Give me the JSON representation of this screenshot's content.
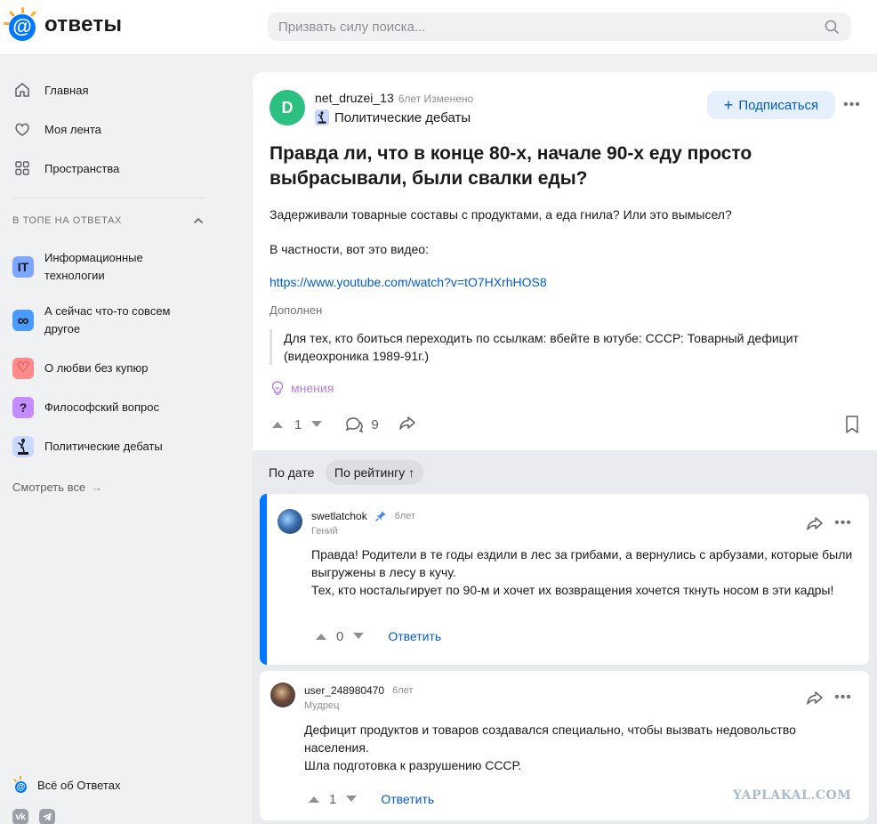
{
  "header": {
    "logo_text": "ответы",
    "search_placeholder": "Призвать силу поиска..."
  },
  "sidebar": {
    "nav": [
      {
        "label": "Главная",
        "icon": "home-icon"
      },
      {
        "label": "Моя лента",
        "icon": "feed-icon"
      },
      {
        "label": "Пространства",
        "icon": "grid-icon"
      }
    ],
    "top_title": "В ТОПЕ НА ОТВЕТАХ",
    "spaces": [
      {
        "label": "Информационные технологии",
        "icon": "it-icon",
        "glyph": "IT",
        "color": "#7da6ff"
      },
      {
        "label": "А сейчас что-то совсем другое",
        "icon": "infinity-icon",
        "glyph": "∞",
        "color": "#4a9bff"
      },
      {
        "label": "О любви без купюр",
        "icon": "heart-icon",
        "glyph": "♡",
        "color": "#ff8a8a"
      },
      {
        "label": "Философский вопрос",
        "icon": "question-icon",
        "glyph": "?",
        "color": "#c48bff"
      },
      {
        "label": "Политические дебаты",
        "icon": "podium-icon",
        "glyph": "",
        "color": "#c9d8ff"
      }
    ],
    "see_all": "Смотреть все",
    "about": "Всё об Ответах",
    "social": [
      {
        "label": "vk",
        "icon": "vk-icon"
      },
      {
        "label": "",
        "icon": "telegram-icon"
      }
    ]
  },
  "question": {
    "avatar_letter": "D",
    "avatar_color": "#2bbf80",
    "author": "net_druzei_13",
    "meta": "6лет Изменено",
    "space": "Политические дебаты",
    "subscribe_label": "Подписаться",
    "title": "Правда ли, что в конце 80-х, начале 90-х еду просто выбрасывали, были свалки еды?",
    "body_1": "Задерживали товарные составы с продуктами, а еда гнила? Или это вымысел?",
    "body_2": "В частности, вот это видео:",
    "link": "https://www.youtube.com/watch?v=tO7HXrhHOS8",
    "added_label": "Дополнен",
    "quote": "Для тех, кто боиться переходить по ссылкам: вбейте в ютубе: СССР: Товарный дефицит (видеохроника 1989-91г.)",
    "opinions_label": "мнения",
    "votes": "1",
    "comments": "9"
  },
  "sort": {
    "by_date": "По дате",
    "by_rating": "По рейтингу ↑"
  },
  "answers": [
    {
      "author": "swetlatchok",
      "time": "6лет",
      "rank": "Гений",
      "text_1": "Правда! Родители в те годы ездили в лес за грибами, а вернулись с арбузами, которые были выгружены в лесу в кучу.",
      "text_2": "Тех, кто ностальгирует по 90-м и хочет их возвращения хочется ткнуть носом в эти кадры!",
      "votes": "0",
      "reply": "Ответить",
      "pinned": true
    },
    {
      "author": "user_248980470",
      "time": "6лет",
      "rank": "Мудрец",
      "text_1": "Дефицит продуктов и товаров создавался специально, чтобы вызвать недовольство населения.",
      "text_2": "Шла подготовка к разрушению СССР.",
      "votes": "1",
      "reply": "Ответить",
      "pinned": false
    }
  ],
  "watermark": "YAPLAKAL.COM",
  "colors": {
    "accent": "#0077ff",
    "link": "#005bd1",
    "logo_ray": "#ffa930",
    "opinions": "#b87de8"
  }
}
